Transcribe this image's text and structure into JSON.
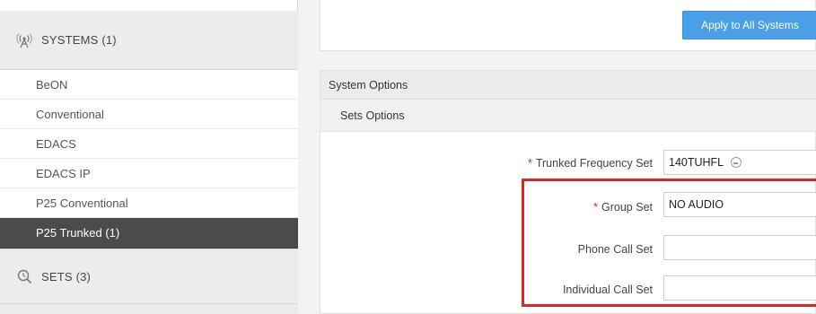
{
  "sidebar": {
    "systems_header": {
      "label": "SYSTEMS (1)",
      "icon": "antenna-icon"
    },
    "items": [
      {
        "label": "BeON"
      },
      {
        "label": "Conventional"
      },
      {
        "label": "EDACS"
      },
      {
        "label": "EDACS IP"
      },
      {
        "label": "P25 Conventional"
      },
      {
        "label": "P25 Trunked (1)",
        "active": true
      }
    ],
    "sets_header": {
      "label": "SETS (3)",
      "icon": "sets-search-icon"
    }
  },
  "main": {
    "apply_button": "Apply to All Systems",
    "system_options_title": "System Options",
    "sets_options_title": "Sets Options",
    "fields": [
      {
        "label": "Trunked Frequency Set",
        "required": true,
        "value": "140TUHFL",
        "has_status_icon": true
      },
      {
        "label": "Group Set",
        "required": true,
        "value": "NO AUDIO"
      },
      {
        "label": "Phone Call Set",
        "required": false,
        "value": ""
      },
      {
        "label": "Individual Call Set",
        "required": false,
        "value": ""
      }
    ],
    "required_marker": "*"
  },
  "colors": {
    "accent_button": "#4a9fe6",
    "active_nav": "#4b4b4b",
    "highlight": "#e02424",
    "required": "#d9261c"
  }
}
